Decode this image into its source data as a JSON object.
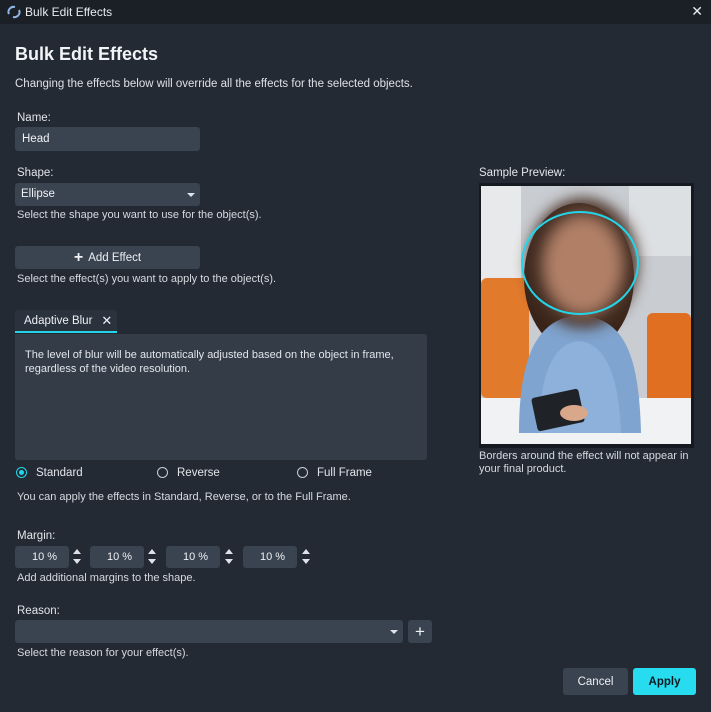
{
  "window": {
    "title": "Bulk Edit Effects",
    "close_icon": "close-icon"
  },
  "heading": "Bulk Edit Effects",
  "subtitle": "Changing the effects below will override all the effects for the selected objects.",
  "name_field": {
    "label": "Name:",
    "value": "Head"
  },
  "shape_field": {
    "label": "Shape:",
    "value": "Ellipse",
    "help": "Select the shape you want to use for the object(s)."
  },
  "add_effect": {
    "label": "Add Effect",
    "icon": "plus-icon",
    "help": "Select the effect(s) you want to apply to the object(s)."
  },
  "effect_tab": {
    "label": "Adaptive Blur",
    "description": "The level of blur will be automatically adjusted based on the object in frame, regardless of the video resolution."
  },
  "mode": {
    "options": [
      "Standard",
      "Reverse",
      "Full Frame"
    ],
    "selected": "Standard",
    "help": "You can apply the effects in Standard, Reverse, or to the Full Frame."
  },
  "margin": {
    "label": "Margin:",
    "fields": [
      {
        "side": "L",
        "value": "10 %"
      },
      {
        "side": "R",
        "value": "10 %"
      },
      {
        "side": "T",
        "value": "10 %"
      },
      {
        "side": "B",
        "value": "10 %"
      }
    ],
    "help": "Add additional margins to the shape."
  },
  "reason": {
    "label": "Reason:",
    "value": "",
    "add_label": "+",
    "help": "Select the reason for your effect(s)."
  },
  "preview": {
    "label": "Sample Preview:",
    "note": "Borders around the effect will not appear in your final product."
  },
  "buttons": {
    "cancel": "Cancel",
    "apply": "Apply"
  },
  "colors": {
    "accent": "#23d5e8",
    "background": "#232a34",
    "field": "#3a4350"
  }
}
